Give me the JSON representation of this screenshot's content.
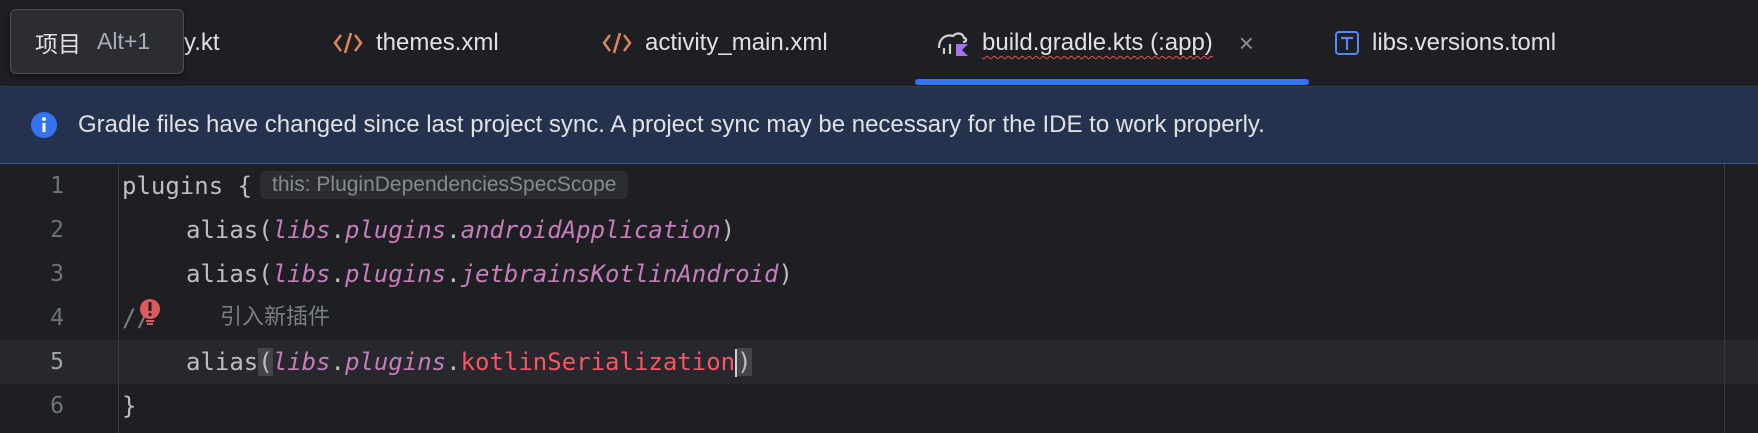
{
  "tabs": [
    {
      "label": "vity.kt",
      "icon": "kotlin-file-icon"
    },
    {
      "label": "themes.xml",
      "icon": "xml-file-icon"
    },
    {
      "label": "activity_main.xml",
      "icon": "xml-file-icon"
    },
    {
      "label": "build.gradle.kts (:app)",
      "icon": "gradle-kts-file-icon",
      "active": true,
      "close": "×"
    },
    {
      "label": "libs.versions.toml",
      "icon": "toml-file-icon"
    }
  ],
  "tooltip": {
    "label": "项目",
    "shortcut": "Alt+1"
  },
  "banner": {
    "message": "Gradle files have changed since last project sync. A project sync may be necessary for the IDE to work properly."
  },
  "editor": {
    "lines": [
      {
        "num": "1",
        "kw": "plugins {",
        "hint": "this: PluginDependenciesSpecScope"
      },
      {
        "num": "2",
        "fn": "alias(",
        "a": "libs",
        "d1": ".",
        "b": "plugins",
        "d2": ".",
        "c": "androidApplication",
        "end": ")"
      },
      {
        "num": "3",
        "fn": "alias(",
        "a": "libs",
        "d1": ".",
        "b": "plugins",
        "d2": ".",
        "c": "jetbrainsKotlinAndroid",
        "end": ")"
      },
      {
        "num": "4",
        "prefix": "//",
        "comment": "引入新插件"
      },
      {
        "num": "5",
        "fn": "alias",
        "open": "(",
        "a": "libs",
        "d1": ".",
        "b": "plugins",
        "d2": ".",
        "c": "kotlinSerialization",
        "end": ")"
      },
      {
        "num": "6",
        "kw": "}"
      }
    ]
  },
  "colors": {
    "accent": "#3574f0",
    "banner_bg": "#25324d",
    "error": "#f75464",
    "property": "#c77dbb"
  }
}
